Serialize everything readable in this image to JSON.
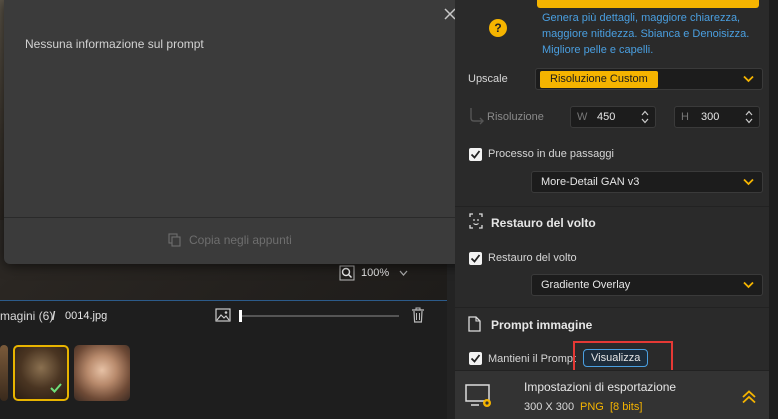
{
  "modal": {
    "message": "Nessuna informazione sul prompt",
    "copy_label": "Copia negli appunti"
  },
  "preview": {
    "zoom": "100%"
  },
  "browser": {
    "images_label": "magini (6)",
    "separator": "/",
    "filename": "0014.jpg"
  },
  "panel": {
    "model_description": "Genera più dettagli, maggiore chiarezza, maggiore nitidezza. Sbianca e Denoisizza. Migliore pelle e capelli.",
    "help_glyph": "?",
    "upscale": {
      "label": "Upscale",
      "value": "Risoluzione Custom"
    },
    "resolution": {
      "label": "Risoluzione",
      "w_label": "W",
      "w_value": "450",
      "h_label": "H",
      "h_value": "300"
    },
    "two_pass": {
      "label": "Processo in due passaggi",
      "checked": true,
      "model": "More-Detail GAN  v3"
    },
    "face_restore": {
      "title": "Restauro del volto",
      "label": "Restauro del volto",
      "checked": true,
      "model": "Gradiente Overlay"
    },
    "prompt": {
      "title": "Prompt immagine",
      "keep_label": "Mantieni il Prompt",
      "checked": true,
      "view_button": "Visualizza"
    },
    "export": {
      "title": "Impostazioni di esportazione",
      "size": "300 X 300",
      "format": "PNG",
      "bits": "[8 bits]"
    }
  },
  "colors": {
    "accent_yellow": "#f5b400",
    "link_blue": "#4a9fe0",
    "highlight_red": "#e53935"
  }
}
